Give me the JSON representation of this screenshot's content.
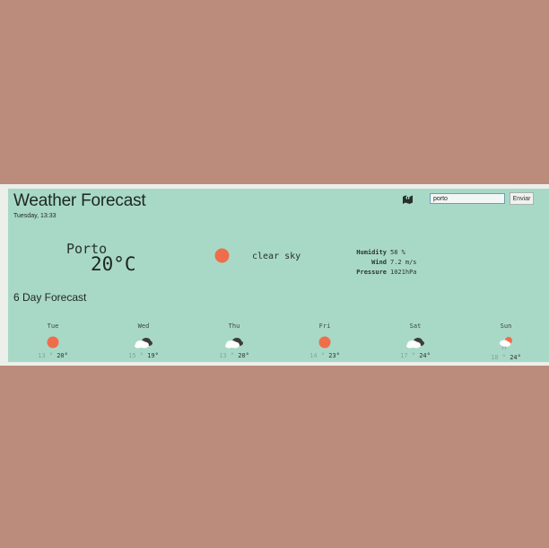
{
  "header": {
    "title": "Weather Forecast",
    "datetime": "Tuesday, 13:33",
    "map_icon": "map-icon"
  },
  "search": {
    "value": "porto",
    "button_label": "Enviar"
  },
  "current": {
    "city": "Porto",
    "temperature": "20°C",
    "icon": "sun-icon",
    "description": "clear sky",
    "details": [
      {
        "label": "Humidity",
        "value": "58 %"
      },
      {
        "label": "Wind",
        "value": "7.2 m/s"
      },
      {
        "label": "Pressure",
        "value": "1021hPa"
      }
    ]
  },
  "forecast": {
    "title": "6 Day Forecast",
    "days": [
      {
        "day": "Tue",
        "icon": "sun-icon",
        "min": "13 °",
        "max": "20°"
      },
      {
        "day": "Wed",
        "icon": "broken-clouds-icon",
        "min": "15 °",
        "max": "19°"
      },
      {
        "day": "Thu",
        "icon": "broken-clouds-icon",
        "min": "13 °",
        "max": "20°"
      },
      {
        "day": "Fri",
        "icon": "sun-icon",
        "min": "14 °",
        "max": "23°"
      },
      {
        "day": "Sat",
        "icon": "broken-clouds-icon",
        "min": "17 °",
        "max": "24°"
      },
      {
        "day": "Sun",
        "icon": "light-rain-icon",
        "min": "18 °",
        "max": "24°"
      }
    ]
  },
  "colors": {
    "page_background": "#bb8b7b",
    "card_background": "#a8d9c6",
    "sun": "#ef6d4b"
  }
}
